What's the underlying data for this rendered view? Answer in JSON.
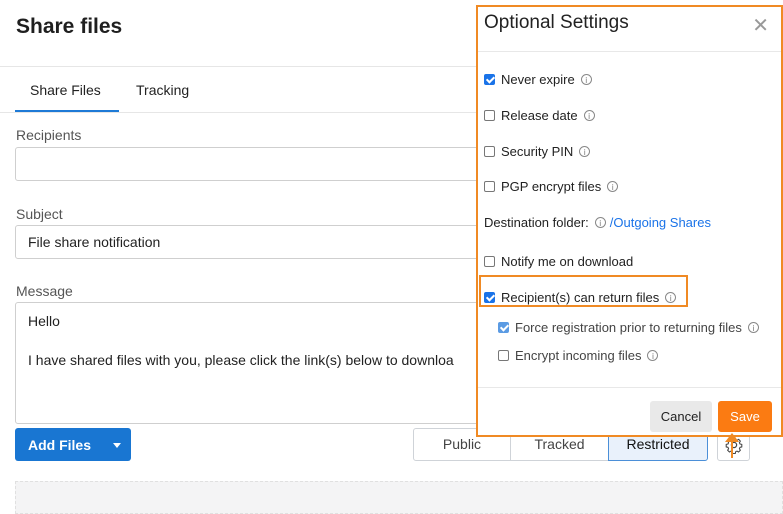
{
  "page": {
    "title": "Share files"
  },
  "tabs": [
    {
      "label": "Share Files"
    },
    {
      "label": "Tracking"
    }
  ],
  "form": {
    "recipients_label": "Recipients",
    "recipients_value": "",
    "subject_label": "Subject",
    "subject_value": "File share notification",
    "message_label": "Message",
    "message_line1": "Hello",
    "message_line2": "I have shared files with you, please click the link(s) below to downloa"
  },
  "actions": {
    "add_files_label": "Add Files",
    "access_options": [
      "Public",
      "Tracked",
      "Restricted"
    ],
    "access_selected": "Restricted"
  },
  "panel": {
    "title": "Optional Settings",
    "close_glyph": "✕",
    "options": {
      "never_expire": {
        "label": "Never expire",
        "checked": true
      },
      "release_date": {
        "label": "Release date",
        "checked": false
      },
      "security_pin": {
        "label": "Security PIN",
        "checked": false
      },
      "pgp_encrypt": {
        "label": "PGP encrypt files",
        "checked": false
      },
      "destination_label": "Destination folder:",
      "destination_link": "/Outgoing Shares",
      "notify_download": {
        "label": "Notify me on download",
        "checked": false
      },
      "recipients_return": {
        "label": "Recipient(s) can return files",
        "checked": true
      },
      "force_registration": {
        "label": "Force registration prior to returning files",
        "checked": true
      },
      "encrypt_incoming": {
        "label": "Encrypt incoming files",
        "checked": false
      }
    },
    "cancel_label": "Cancel",
    "save_label": "Save"
  },
  "colors": {
    "accent_blue": "#1976d2",
    "highlight_orange": "#f08a24",
    "save_orange": "#fb7b12",
    "link_blue": "#1a73e8"
  }
}
